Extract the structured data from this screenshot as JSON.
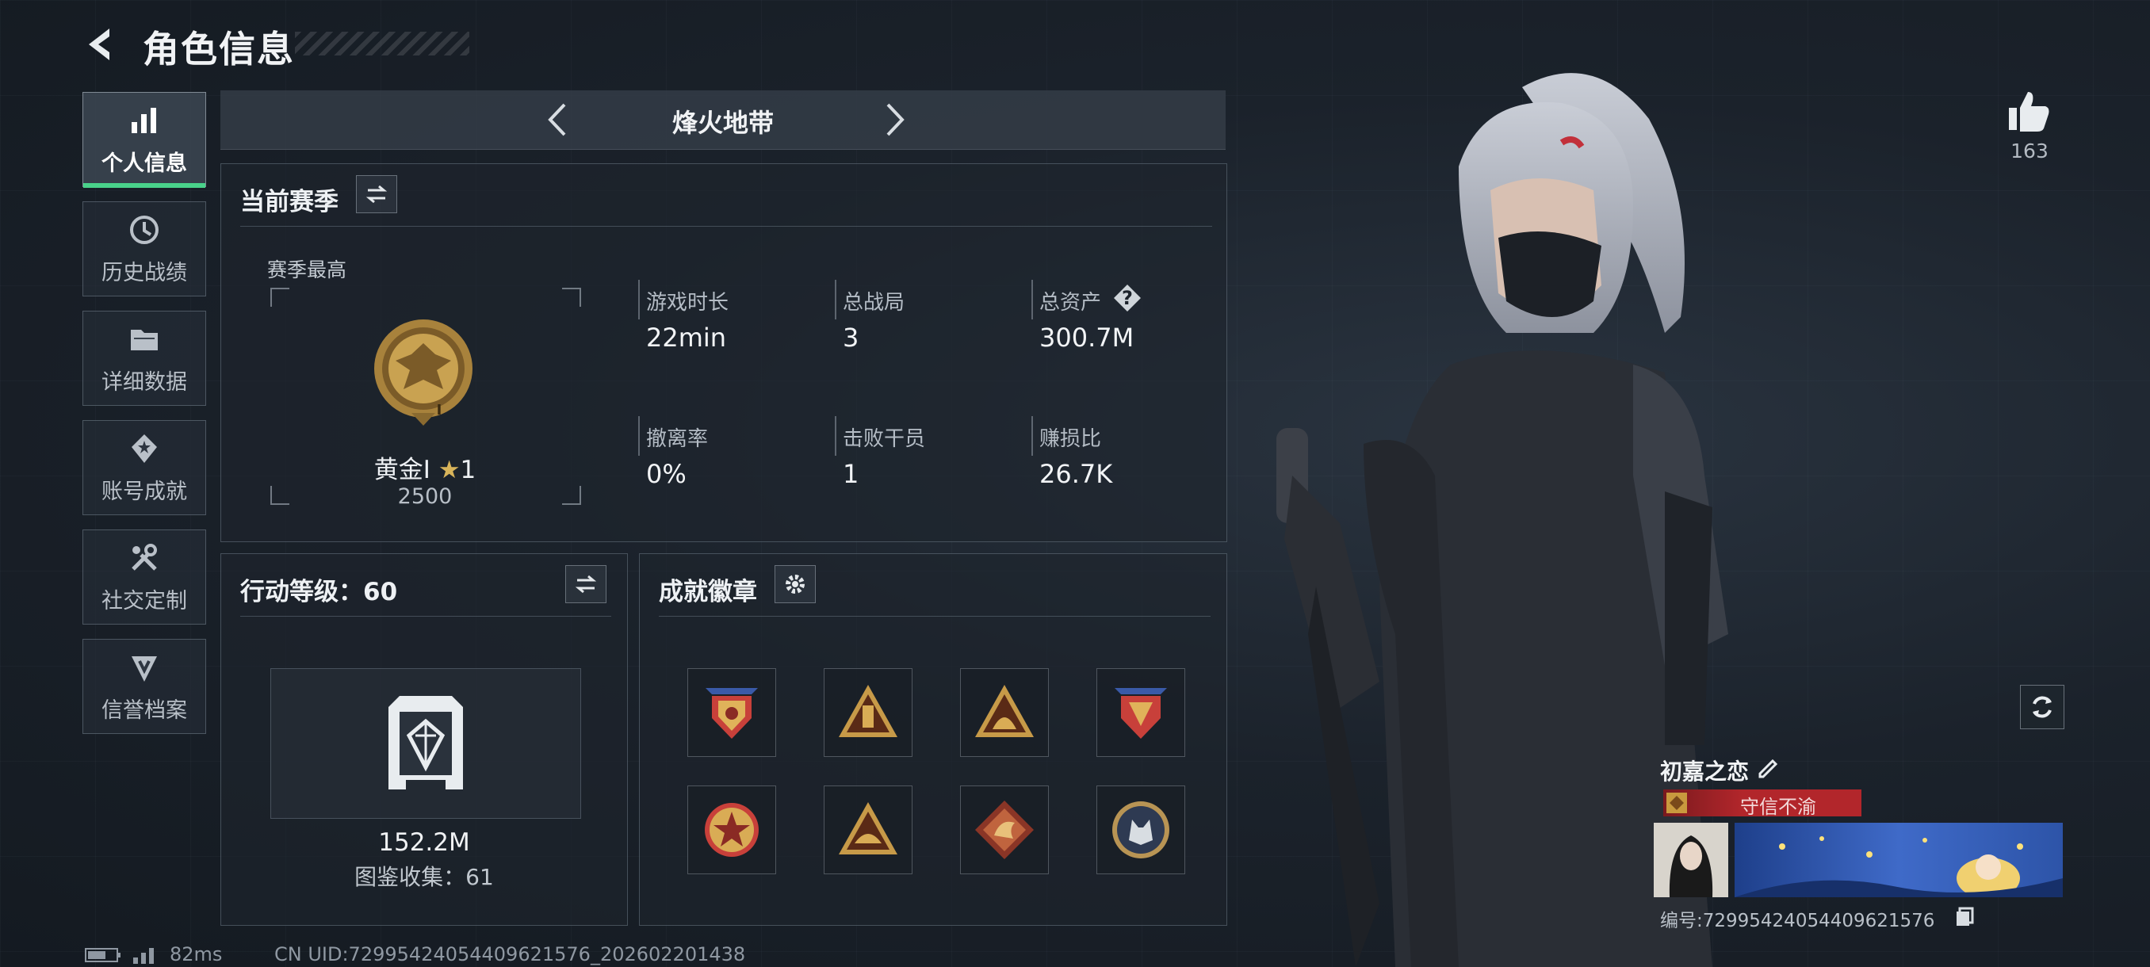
{
  "header": {
    "title": "角色信息"
  },
  "sidebar": {
    "items": [
      {
        "label": "个人信息",
        "icon": "bar-chart-icon"
      },
      {
        "label": "历史战绩",
        "icon": "history-icon"
      },
      {
        "label": "详细数据",
        "icon": "folder-icon"
      },
      {
        "label": "账号成就",
        "icon": "achievement-icon"
      },
      {
        "label": "社交定制",
        "icon": "tools-icon"
      },
      {
        "label": "信誉档案",
        "icon": "shield-icon"
      }
    ]
  },
  "mode": {
    "title": "烽火地带"
  },
  "season": {
    "title": "当前赛季",
    "best_label": "赛季最高",
    "rank_name": "黄金I",
    "rank_stars": "1",
    "rank_score": "2500",
    "rank_level": "I",
    "stats": [
      {
        "label": "游戏时长",
        "value": "22min"
      },
      {
        "label": "总战局",
        "value": "3"
      },
      {
        "label": "总资产",
        "value": "300.7M",
        "help": "?"
      },
      {
        "label": "撤离率",
        "value": "0%"
      },
      {
        "label": "击败干员",
        "value": "1"
      },
      {
        "label": "赚损比",
        "value": "26.7K"
      }
    ]
  },
  "action_level": {
    "title": "行动等级：60",
    "value": "152.2M",
    "collection": "图鉴收集：61"
  },
  "achievements": {
    "title": "成就徽章",
    "badges": [
      "badge-shield-star",
      "badge-triangle-pillar",
      "badge-triangle-figure",
      "badge-shield-star-2",
      "badge-round-star",
      "badge-triangle-dome",
      "badge-dragon-diamond",
      "badge-wolf-circle"
    ]
  },
  "profile": {
    "likes": "163",
    "nickname": "初嘉之恋",
    "title_tag": "守信不渝",
    "uid_label": "编号:7299542405440962157​6"
  },
  "footer": {
    "ping": "82ms",
    "uid": "CN UID:7299542405440962157​6_202602201438"
  },
  "colors": {
    "active_accent": "#49d28a",
    "title_tag_bg": "#b2262b",
    "rank_gold": "#c9a251"
  }
}
